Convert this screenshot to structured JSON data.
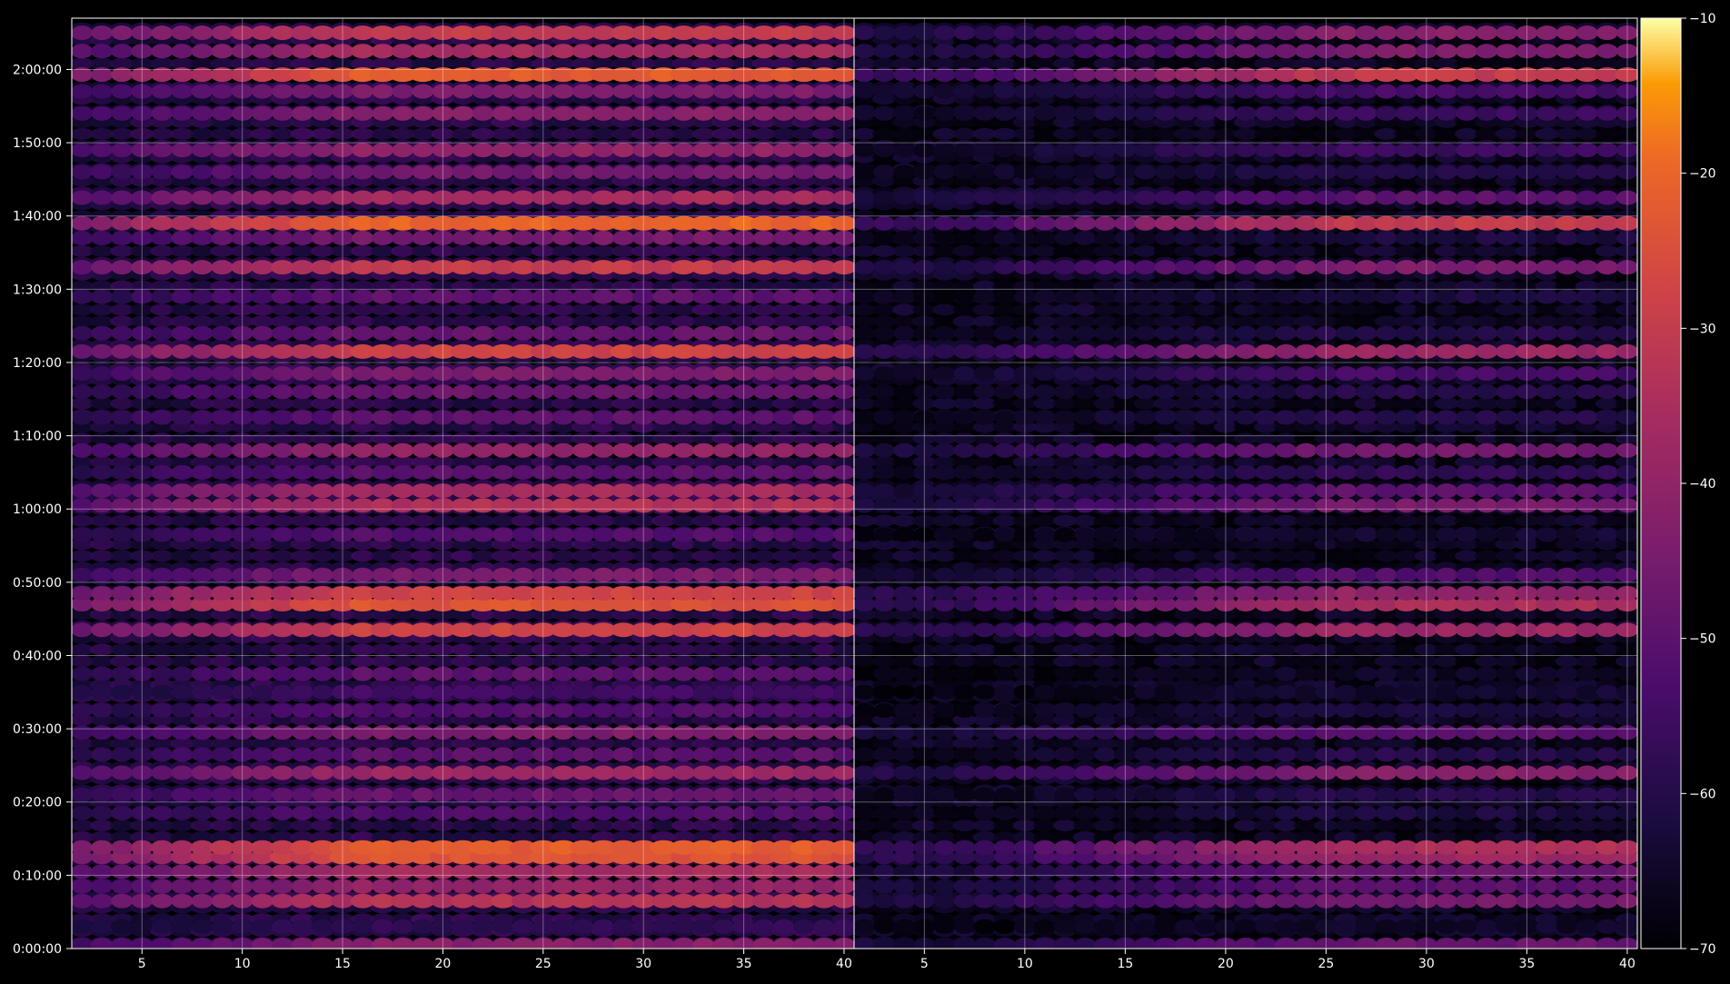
{
  "chart_data": {
    "type": "heatmap",
    "colormap": "inferno",
    "background": "#000000",
    "grid": true,
    "grid_color": "#ffffff",
    "panels": [
      {
        "name": "",
        "x_ticks": [
          "5",
          "10",
          "15",
          "20",
          "25",
          "30",
          "35",
          "40"
        ],
        "x_range": [
          1.5,
          40.5
        ]
      },
      {
        "name": "",
        "x_ticks": [
          "5",
          "10",
          "15",
          "20",
          "25",
          "30",
          "35",
          "40"
        ],
        "x_range": [
          1.5,
          40.5
        ]
      }
    ],
    "y_ticks": [
      "0:00:00",
      "0:10:00",
      "0:20:00",
      "0:30:00",
      "0:40:00",
      "0:50:00",
      "1:00:00",
      "1:10:00",
      "1:20:00",
      "1:30:00",
      "1:40:00",
      "1:50:00",
      "2:00:00"
    ],
    "y_range_minutes": [
      0,
      127
    ],
    "colorbar": {
      "ticks": [
        "-10",
        "-20",
        "-30",
        "-40",
        "-50",
        "-60",
        "-70"
      ],
      "min": -70,
      "max": -10,
      "position": "right"
    },
    "bands_minutes": [
      {
        "t": 0.5,
        "left": -42,
        "right": -48
      },
      {
        "t": 3,
        "left": -58,
        "right": -65
      },
      {
        "t": 6.5,
        "left": -33,
        "right": -45
      },
      {
        "t": 8.5,
        "left": -40,
        "right": -50
      },
      {
        "t": 10.5,
        "left": -36,
        "right": -48
      },
      {
        "t": 12.5,
        "left": -24,
        "right": -38
      },
      {
        "t": 13.8,
        "left": -22,
        "right": -34
      },
      {
        "t": 18.5,
        "left": -52,
        "right": -62
      },
      {
        "t": 21,
        "left": -48,
        "right": -60
      },
      {
        "t": 24,
        "left": -38,
        "right": -42
      },
      {
        "t": 26.5,
        "left": -50,
        "right": -60
      },
      {
        "t": 29.5,
        "left": -44,
        "right": -50
      },
      {
        "t": 32.5,
        "left": -52,
        "right": -62
      },
      {
        "t": 35,
        "left": -55,
        "right": -64
      },
      {
        "t": 37.5,
        "left": -50,
        "right": -65
      },
      {
        "t": 43.5,
        "left": -28,
        "right": -38
      },
      {
        "t": 47,
        "left": -24,
        "right": -35
      },
      {
        "t": 48.5,
        "left": -28,
        "right": -40
      },
      {
        "t": 51,
        "left": -44,
        "right": -52
      },
      {
        "t": 56.5,
        "left": -52,
        "right": -64
      },
      {
        "t": 60.5,
        "left": -34,
        "right": -45
      },
      {
        "t": 62.5,
        "left": -36,
        "right": -50
      },
      {
        "t": 65,
        "left": -50,
        "right": -58
      },
      {
        "t": 68,
        "left": -40,
        "right": -46
      },
      {
        "t": 72.5,
        "left": -50,
        "right": -60
      },
      {
        "t": 76,
        "left": -48,
        "right": -60
      },
      {
        "t": 78.5,
        "left": -44,
        "right": -54
      },
      {
        "t": 81.5,
        "left": -28,
        "right": -38
      },
      {
        "t": 84,
        "left": -48,
        "right": -60
      },
      {
        "t": 89,
        "left": -50,
        "right": -62
      },
      {
        "t": 93,
        "left": -30,
        "right": -44
      },
      {
        "t": 97,
        "left": -45,
        "right": -62
      },
      {
        "t": 99,
        "left": -20,
        "right": -30
      },
      {
        "t": 102.5,
        "left": -36,
        "right": -50
      },
      {
        "t": 106,
        "left": -46,
        "right": -60
      },
      {
        "t": 109,
        "left": -40,
        "right": -56
      },
      {
        "t": 114,
        "left": -42,
        "right": -56
      },
      {
        "t": 117,
        "left": -44,
        "right": -54
      },
      {
        "t": 119.3,
        "left": -22,
        "right": -30
      },
      {
        "t": 122.5,
        "left": -36,
        "right": -44
      },
      {
        "t": 125,
        "left": -30,
        "right": -42
      }
    ]
  }
}
